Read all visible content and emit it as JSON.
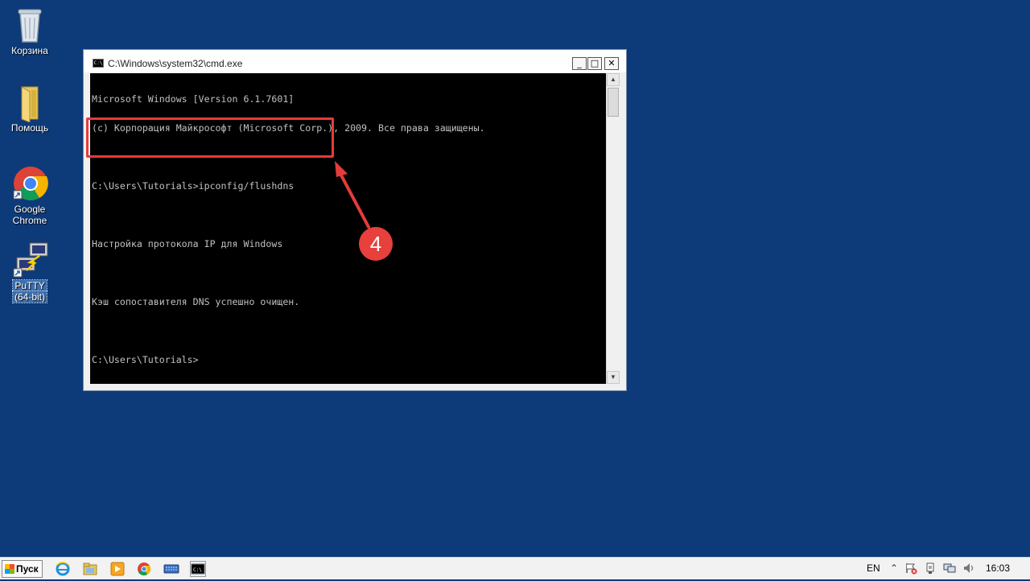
{
  "desktop": {
    "icons": [
      {
        "label": "Корзина"
      },
      {
        "label": "Помощь"
      },
      {
        "label": "Google\nChrome",
        "line1": "Google",
        "line2": "Chrome"
      },
      {
        "label": "PuTTY (64-bit)",
        "line1": "PuTTY",
        "line2": "(64-bit)"
      }
    ]
  },
  "window": {
    "title": "C:\\Windows\\system32\\cmd.exe",
    "icon_text": "C:\\",
    "minimize": "_",
    "maximize": "□",
    "close": "✕"
  },
  "console": {
    "lines": [
      "Microsoft Windows [Version 6.1.7601]",
      "(c) Корпорация Майкрософт (Microsoft Corp.), 2009. Все права защищены.",
      "",
      "C:\\Users\\Tutorials>ipconfig/flushdns",
      "",
      "Настройка протокола IP для Windows",
      "",
      "Кэш сопоставителя DNS успешно очищен.",
      "",
      "C:\\Users\\Tutorials>"
    ]
  },
  "annotation": {
    "step": "4",
    "color": "#e63b3b"
  },
  "taskbar": {
    "start_label": "Пуск",
    "language": "EN",
    "time": "16:03"
  }
}
